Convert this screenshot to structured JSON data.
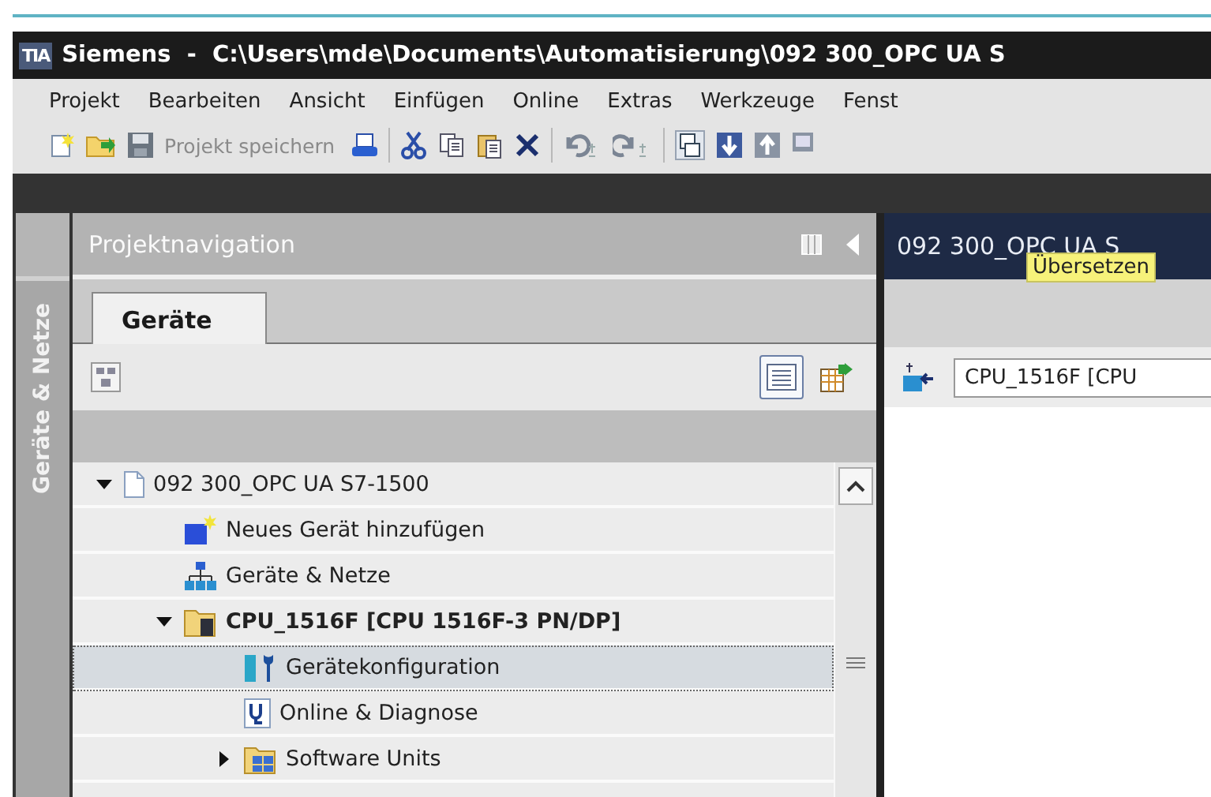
{
  "window": {
    "logo": "TIA",
    "title": "Siemens  -  C:\\Users\\mde\\Documents\\Automatisierung\\092 300_OPC UA S"
  },
  "menu": [
    "Projekt",
    "Bearbeiten",
    "Ansicht",
    "Einfügen",
    "Online",
    "Extras",
    "Werkzeuge",
    "Fenst"
  ],
  "toolbar": {
    "save_label": "Projekt speichern"
  },
  "side_tab": {
    "label": "Geräte & Netze"
  },
  "navigation": {
    "title": "Projektnavigation",
    "tabs": [
      {
        "label": "Geräte",
        "selected": true
      }
    ],
    "tree": [
      {
        "label": "092 300_OPC UA S7-1500",
        "kind": "project",
        "expanded": true,
        "selected": false,
        "children": [
          {
            "label": "Neues Gerät hinzufügen",
            "kind": "add-device",
            "selected": false
          },
          {
            "label": "Geräte & Netze",
            "kind": "network",
            "selected": false
          },
          {
            "label": "CPU_1516F [CPU 1516F-3 PN/DP]",
            "kind": "device",
            "expanded": true,
            "selected": false,
            "children": [
              {
                "label": "Gerätekonfiguration",
                "kind": "config",
                "selected": true
              },
              {
                "label": "Online & Diagnose",
                "kind": "diagnose",
                "selected": false
              },
              {
                "label": "Software Units",
                "kind": "folder",
                "expanded": false,
                "selected": false
              }
            ]
          }
        ]
      }
    ]
  },
  "editor": {
    "title": "092 300_OPC UA S",
    "tooltip": "Übersetzen",
    "device_field": "CPU_1516F [CPU"
  }
}
